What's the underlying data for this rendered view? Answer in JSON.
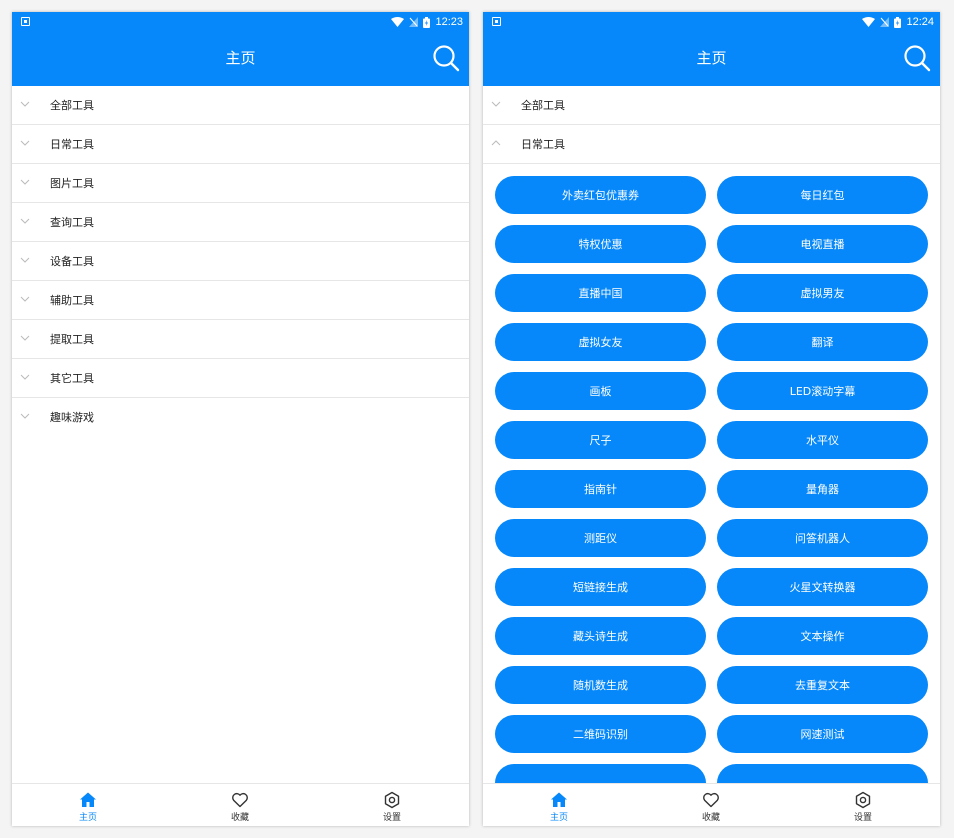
{
  "colors": {
    "primary": "#0788fa",
    "tab_inactive": "#333333",
    "divider": "#e6e6e6"
  },
  "left": {
    "status_time": "12:23",
    "title": "主页",
    "categories": [
      {
        "label": "全部工具",
        "expanded": false
      },
      {
        "label": "日常工具",
        "expanded": false
      },
      {
        "label": "图片工具",
        "expanded": false
      },
      {
        "label": "查询工具",
        "expanded": false
      },
      {
        "label": "设备工具",
        "expanded": false
      },
      {
        "label": "辅助工具",
        "expanded": false
      },
      {
        "label": "提取工具",
        "expanded": false
      },
      {
        "label": "其它工具",
        "expanded": false
      },
      {
        "label": "趣味游戏",
        "expanded": false
      }
    ],
    "tabs": [
      {
        "label": "主页",
        "icon": "home-icon",
        "active": true
      },
      {
        "label": "收藏",
        "icon": "heart-icon",
        "active": false
      },
      {
        "label": "设置",
        "icon": "gear-icon",
        "active": false
      }
    ]
  },
  "right": {
    "status_time": "12:24",
    "title": "主页",
    "categories": [
      {
        "label": "全部工具",
        "expanded": false
      },
      {
        "label": "日常工具",
        "expanded": true
      }
    ],
    "tools": [
      "外卖红包优惠券",
      "每日红包",
      "特权优惠",
      "电视直播",
      "直播中国",
      "虚拟男友",
      "虚拟女友",
      "翻译",
      "画板",
      "LED滚动字幕",
      "尺子",
      "水平仪",
      "指南针",
      "量角器",
      "测距仪",
      "问答机器人",
      "短链接生成",
      "火星文转换器",
      "藏头诗生成",
      "文本操作",
      "随机数生成",
      "去重复文本",
      "二维码识别",
      "网速测试",
      "",
      ""
    ],
    "tabs": [
      {
        "label": "主页",
        "icon": "home-icon",
        "active": true
      },
      {
        "label": "收藏",
        "icon": "heart-icon",
        "active": false
      },
      {
        "label": "设置",
        "icon": "gear-icon",
        "active": false
      }
    ]
  }
}
